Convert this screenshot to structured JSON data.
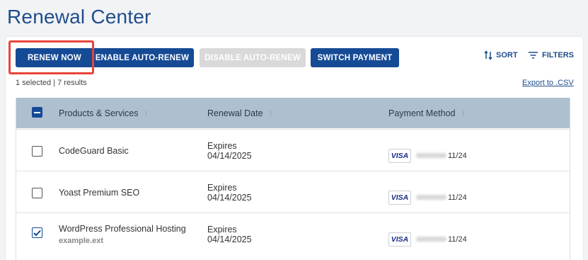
{
  "page": {
    "title": "Renewal Center"
  },
  "toolbar": {
    "renew_now": "RENEW NOW",
    "enable_auto_renew": "ENABLE AUTO-RENEW",
    "disable_auto_renew": "DISABLE AUTO-RENEW",
    "switch_payment": "SWITCH PAYMENT",
    "sort": "SORT",
    "filters": "FILTERS"
  },
  "summary": {
    "selection_text": "1 selected | 7 results",
    "export_link": "Export to .CSV"
  },
  "table": {
    "columns": [
      "Products & Services",
      "Renewal Date",
      "Payment Method"
    ],
    "rows": [
      {
        "product": "CodeGuard Basic",
        "sub": "",
        "status": "Expires",
        "date": "04/14/2025",
        "card_brand": "VISA",
        "card_expiry": "11/24",
        "checked": false
      },
      {
        "product": "Yoast Premium SEO",
        "sub": "",
        "status": "Expires",
        "date": "04/14/2025",
        "card_brand": "VISA",
        "card_expiry": "11/24",
        "checked": false
      },
      {
        "product": "WordPress Professional Hosting",
        "sub": "example.ext",
        "status": "Expires",
        "date": "04/14/2025",
        "card_brand": "VISA",
        "card_expiry": "11/24",
        "checked": true
      }
    ]
  },
  "colors": {
    "brand": "#154a95",
    "title": "#1f4e8c",
    "header_bg": "#aebfcf",
    "highlight": "#e8443a",
    "disabled": "#d9d9d9"
  },
  "icons": {
    "sort": "sort-arrows-icon",
    "filters": "filter-lines-icon",
    "column_sort": "arrow-up-icon"
  }
}
